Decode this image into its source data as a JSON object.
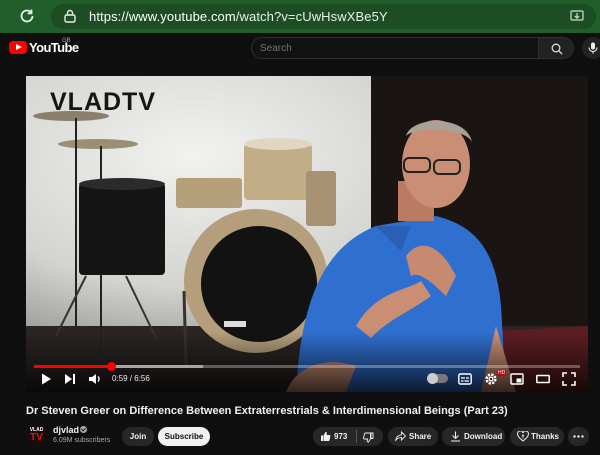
{
  "browser": {
    "url_domain": "https://www.youtube.com",
    "url_path": "/watch?v=cUwHswXBe5Y"
  },
  "header": {
    "logo_text": "YouTube",
    "region_code": "GB",
    "search_placeholder": "Search"
  },
  "player": {
    "watermark": "VLADTV",
    "current_time": "0:59",
    "duration": "6:56",
    "time_display": "0:59 / 6:56",
    "progress_fraction": 0.142,
    "buffered_fraction": 0.31,
    "quality_badge": "HD",
    "autoplay_on": false
  },
  "video": {
    "title": "Dr Steven Greer on Difference Between Extraterrestrials & Interdimensional Beings (Part 23)"
  },
  "channel": {
    "avatar_line1": "VLAD",
    "avatar_line2": "TV",
    "name": "djvlad",
    "subscribers": "6.09M subscribers"
  },
  "actions": {
    "join": "Join",
    "subscribe": "Subscribe",
    "likes": "973",
    "share": "Share",
    "download": "Download",
    "thanks": "Thanks"
  },
  "colors": {
    "browser_bar": "#215e2b",
    "brand_red": "#ff0000",
    "page_bg": "#0f0f0f"
  }
}
